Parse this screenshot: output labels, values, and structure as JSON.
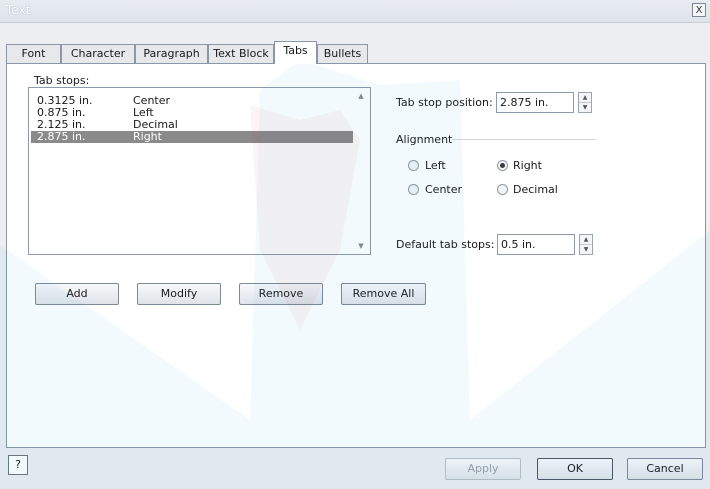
{
  "window": {
    "title": "Text",
    "close_label": "X"
  },
  "tabs": [
    {
      "label": "Font"
    },
    {
      "label": "Character"
    },
    {
      "label": "Paragraph"
    },
    {
      "label": "Text Block"
    },
    {
      "label": "Tabs"
    },
    {
      "label": "Bullets"
    }
  ],
  "tab_stops": {
    "label": "Tab stops:",
    "items": [
      {
        "position": "0.3125 in.",
        "alignment": "Center"
      },
      {
        "position": "0.875 in.",
        "alignment": "Left"
      },
      {
        "position": "2.125 in.",
        "alignment": "Decimal"
      },
      {
        "position": "2.875 in.",
        "alignment": "Right"
      }
    ],
    "selected_index": 3
  },
  "tab_stop_position": {
    "label": "Tab stop position:",
    "value": "2.875 in."
  },
  "alignment": {
    "label": "Alignment",
    "options": [
      {
        "label": "Left",
        "checked": false
      },
      {
        "label": "Right",
        "checked": true
      },
      {
        "label": "Center",
        "checked": false
      },
      {
        "label": "Decimal",
        "checked": false
      }
    ]
  },
  "default_tab_stops": {
    "label": "Default tab stops:",
    "value": "0.5 in."
  },
  "list_buttons": {
    "add": "Add",
    "modify": "Modify",
    "remove": "Remove",
    "remove_all": "Remove All"
  },
  "footer": {
    "help": "?",
    "apply": "Apply",
    "ok": "OK",
    "cancel": "Cancel"
  },
  "icons": {
    "help": "help-icon",
    "scroll_up": "scroll-up-arrow-icon",
    "scroll_down": "scroll-down-arrow-icon"
  },
  "colors": {
    "selection": "#8a8a8a",
    "accent": "#7f8896"
  }
}
